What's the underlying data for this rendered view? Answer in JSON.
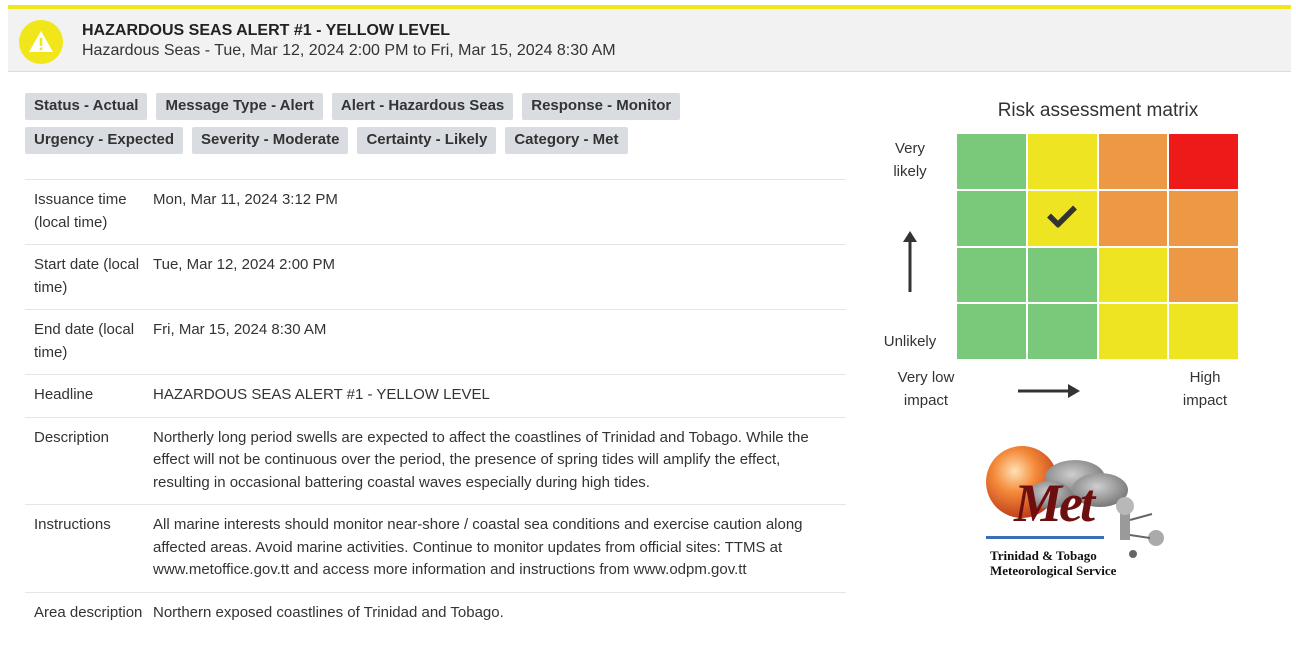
{
  "header": {
    "title": "HAZARDOUS SEAS ALERT #1 - YELLOW LEVEL",
    "subtitle": "Hazardous Seas - Tue, Mar 12, 2024 2:00 PM to Fri, Mar 15, 2024 8:30 AM",
    "accent_color": "#f1e61a",
    "icon": "warning-icon"
  },
  "tags": {
    "row1": [
      "Status - Actual",
      "Message Type - Alert",
      "Alert - Hazardous Seas",
      "Response - Monitor"
    ],
    "row2": [
      "Urgency - Expected",
      "Severity - Moderate",
      "Certainty - Likely",
      "Category - Met"
    ]
  },
  "details": [
    {
      "key": "Issuance time (local time)",
      "value": "Mon, Mar 11, 2024 3:12 PM"
    },
    {
      "key": "Start date (local time)",
      "value": "Tue, Mar 12, 2024 2:00 PM"
    },
    {
      "key": "End date (local time)",
      "value": "Fri, Mar 15, 2024 8:30 AM"
    },
    {
      "key": "Headline",
      "value": "HAZARDOUS SEAS ALERT #1 - YELLOW LEVEL"
    },
    {
      "key": "Description",
      "value": "Northerly long period swells are expected to affect the coastlines of Trinidad and Tobago. While the effect will not be continuous over the period, the presence of spring tides will amplify the effect, resulting in occasional battering coastal waves especially during high tides."
    },
    {
      "key": "Instructions",
      "value": "All marine interests should monitor near-shore / coastal sea conditions and exercise caution along affected areas. Avoid marine activities. Continue to monitor updates from official sites: TTMS at www.metoffice.gov.tt and access more information and instructions from www.odpm.gov.tt"
    },
    {
      "key": "Area description",
      "value": "Northern exposed coastlines of Trinidad and Tobago."
    }
  ],
  "risk_matrix": {
    "title": "Risk assessment matrix",
    "y_top_label": "Very likely",
    "y_bottom_label": "Unlikely",
    "x_left_label": "Very low impact",
    "x_right_label": "High impact",
    "colors": {
      "green": "#7ac97a",
      "yellow": "#efe421",
      "orange": "#ec9844",
      "red": "#ee1a1a"
    },
    "grid": [
      [
        "green",
        "yellow",
        "orange",
        "red"
      ],
      [
        "green",
        "yellow",
        "orange",
        "orange"
      ],
      [
        "green",
        "green",
        "yellow",
        "orange"
      ],
      [
        "green",
        "green",
        "yellow",
        "yellow"
      ]
    ],
    "selected": {
      "row": 1,
      "col": 1
    }
  },
  "logo": {
    "wordmark": "Met",
    "line1": "Trinidad & Tobago",
    "line2": "Meteorological Service"
  }
}
